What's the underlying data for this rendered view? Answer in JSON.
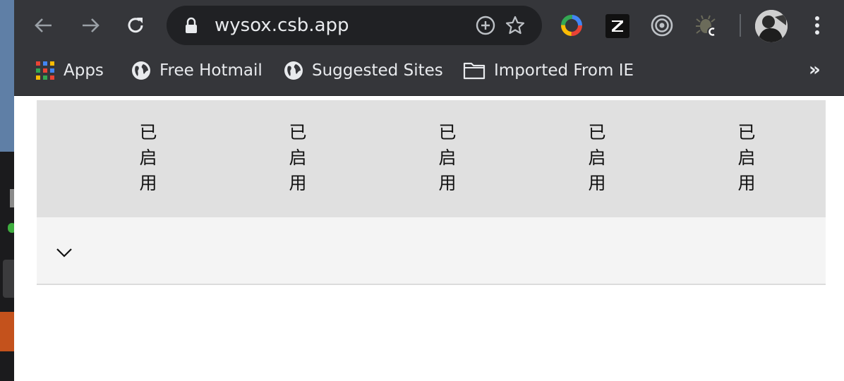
{
  "browser": {
    "url": "wysox.csb.app",
    "bookmarks": [
      {
        "label": "Apps",
        "icon": "apps-grid-icon"
      },
      {
        "label": "Free Hotmail",
        "icon": "globe-icon"
      },
      {
        "label": "Suggested Sites",
        "icon": "globe-icon"
      },
      {
        "label": "Imported From IE",
        "icon": "folder-icon"
      }
    ],
    "overflow": "»"
  },
  "table": {
    "headers": [
      "已\n启\n用",
      "已\n启\n用",
      "已\n启\n用",
      "已\n启\n用",
      "已\n启\n用"
    ]
  }
}
